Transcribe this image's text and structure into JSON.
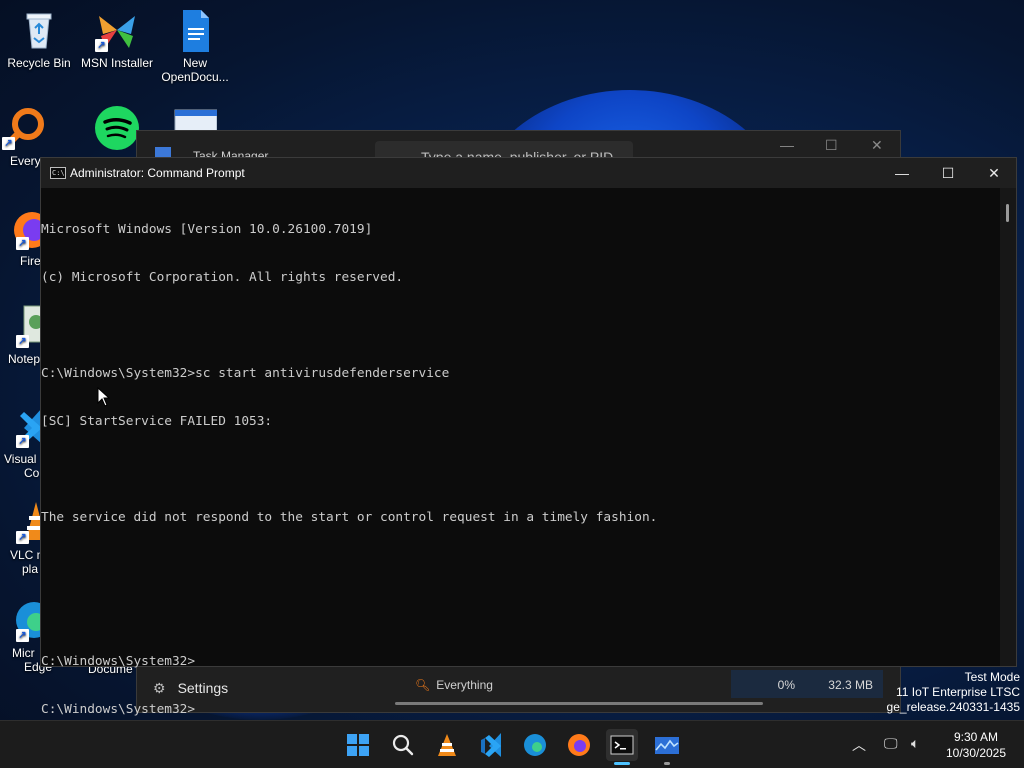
{
  "desktop": {
    "icons": [
      {
        "label": "Recycle Bin"
      },
      {
        "label": "MSN Installer"
      },
      {
        "label": "New OpenDocu..."
      },
      {
        "label": "Every"
      },
      {
        "label": "Fire"
      },
      {
        "label": "Notep"
      },
      {
        "label": "Visual"
      },
      {
        "label": "Co"
      },
      {
        "label": "VLC m"
      },
      {
        "label": "pla"
      },
      {
        "label": "Micr"
      },
      {
        "label": "Edge"
      },
      {
        "label": "Docume"
      }
    ]
  },
  "task_manager": {
    "title": "Task Manager",
    "search_placeholder": "Type a name, publisher, or PID",
    "footer_settings": "Settings",
    "process_name": "Everything",
    "cpu": "0%",
    "memory": "32.3 MB"
  },
  "cmd": {
    "title": "Administrator: Command Prompt",
    "lines": [
      "Microsoft Windows [Version 10.0.26100.7019]",
      "(c) Microsoft Corporation. All rights reserved.",
      "",
      "C:\\Windows\\System32>sc start antivirusdefenderservice",
      "[SC] StartService FAILED 1053:",
      "",
      "The service did not respond to the start or control request in a timely fashion.",
      "",
      "",
      "C:\\Windows\\System32>",
      "C:\\Windows\\System32>"
    ]
  },
  "system_info": {
    "line1": "Test Mode",
    "line2": "11 IoT Enterprise LTSC",
    "line3": "ge_release.240331-1435"
  },
  "taskbar": {
    "time": "9:30 AM",
    "date": "10/30/2025"
  },
  "colors": {
    "terminal_bg": "#0c0c0c",
    "terminal_text": "#cccccc",
    "accent": "#4cc2ff"
  }
}
